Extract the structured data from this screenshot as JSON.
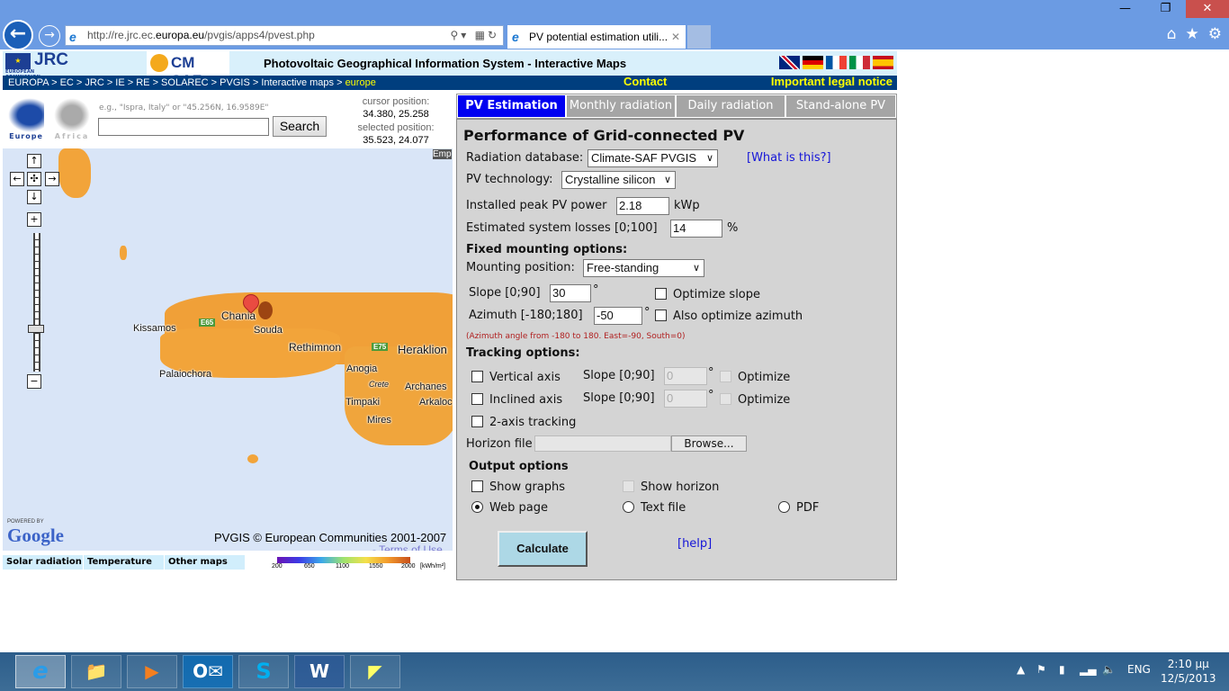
{
  "window": {
    "minimize_icon": "minimize-icon",
    "restore_icon": "restore-icon",
    "close_icon": "close-icon"
  },
  "browser": {
    "url_prefix": "http://re.jrc.ec.",
    "url_domain": "europa.eu",
    "url_path": "/pvgis/apps4/pvest.php",
    "tab_title": "PV potential estimation utili...",
    "toolbar_icons": [
      "home-icon",
      "favorites-star-icon",
      "settings-gear-icon"
    ]
  },
  "header": {
    "jrc_logo": "JRC",
    "jrc_sub": "EUROPEAN COMMISSION",
    "cmsaf_logo": "CM SAF",
    "title": "Photovoltaic Geographical Information System - Interactive Maps",
    "languages": [
      "English",
      "Deutsch",
      "Français",
      "Italiano",
      "Español"
    ]
  },
  "breadcrumb": {
    "path": "EUROPA > EC > JRC > IE > RE > SOLAREC > PVGIS > Interactive maps > ",
    "current": "europe",
    "contact": "Contact",
    "legal": "Important legal notice"
  },
  "search": {
    "regions": [
      "Europe",
      "Africa"
    ],
    "hint": "e.g., \"Ispra, Italy\" or \"45.256N, 16.9589E\"",
    "value": "",
    "button": "Search",
    "cursor_label": "cursor position:",
    "cursor_value": "34.380, 25.258",
    "selected_label": "selected position:",
    "selected_value": "35.523, 24.077"
  },
  "map": {
    "towns": [
      "Kissamos",
      "Chania",
      "Souda",
      "Rethimnon",
      "Heraklion",
      "Palaiochora",
      "Anogia",
      "Crete",
      "Archanes",
      "Timpaki",
      "Arkaloc",
      "Mires",
      "Emp"
    ],
    "roads": [
      "E65",
      "E75"
    ],
    "powered_by": "POWERED BY",
    "google": "Google",
    "copyright": "PVGIS © European Communities 2001-2007",
    "terms": "- Terms of Use",
    "map_tabs": [
      "Solar radiation",
      "Temperature",
      "Other maps"
    ],
    "legend_ticks": [
      "200",
      "650",
      "1100",
      "1550",
      "2000"
    ],
    "legend_unit": "[kWh/m²]"
  },
  "tabs": [
    {
      "label": "PV Estimation",
      "active": true
    },
    {
      "label": "Monthly radiation",
      "active": false
    },
    {
      "label": "Daily radiation",
      "active": false
    },
    {
      "label": "Stand-alone PV",
      "active": false
    }
  ],
  "form": {
    "title": "Performance of Grid-connected PV",
    "radiation_db_label": "Radiation database:",
    "radiation_db_value": "Climate-SAF PVGIS",
    "what_is_this": "[What is this?]",
    "pv_tech_label": "PV technology:",
    "pv_tech_value": "Crystalline silicon",
    "peak_power_label": "Installed peak PV power",
    "peak_power_value": "2.18",
    "peak_power_unit": "kWp",
    "losses_label": "Estimated system losses [0;100]",
    "losses_value": "14",
    "losses_unit": "%",
    "fixed_heading": "Fixed mounting options:",
    "mounting_label": "Mounting position:",
    "mounting_value": "Free-standing",
    "slope_label": "Slope [0;90]",
    "slope_value": "30",
    "degree": "°",
    "optimize_slope": "Optimize slope",
    "azimuth_label": "Azimuth [-180;180]",
    "azimuth_value": "-50",
    "optimize_azimuth": "Also optimize azimuth",
    "azimuth_note": "(Azimuth angle from -180 to 180. East=-90, South=0)",
    "tracking_heading": "Tracking options:",
    "vertical_axis": "Vertical axis",
    "inclined_axis": "Inclined axis",
    "tracking_slope_label": "Slope [0;90]",
    "vertical_slope_value": "0",
    "inclined_slope_value": "0",
    "optimize": "Optimize",
    "two_axis": "2-axis tracking",
    "horizon_label": "Horizon file",
    "browse": "Browse...",
    "output_heading": "Output options",
    "show_graphs": "Show graphs",
    "show_horizon": "Show horizon",
    "web_page": "Web page",
    "text_file": "Text file",
    "pdf": "PDF",
    "output_selected": "Web page",
    "calculate": "Calculate",
    "help": "[help]"
  },
  "taskbar": {
    "apps": [
      "Internet Explorer",
      "File Explorer",
      "Windows Media Player",
      "Outlook",
      "Skype",
      "Word",
      "Drawing App"
    ],
    "language": "ENG",
    "time": "2:10 μμ",
    "date": "12/5/2013"
  }
}
